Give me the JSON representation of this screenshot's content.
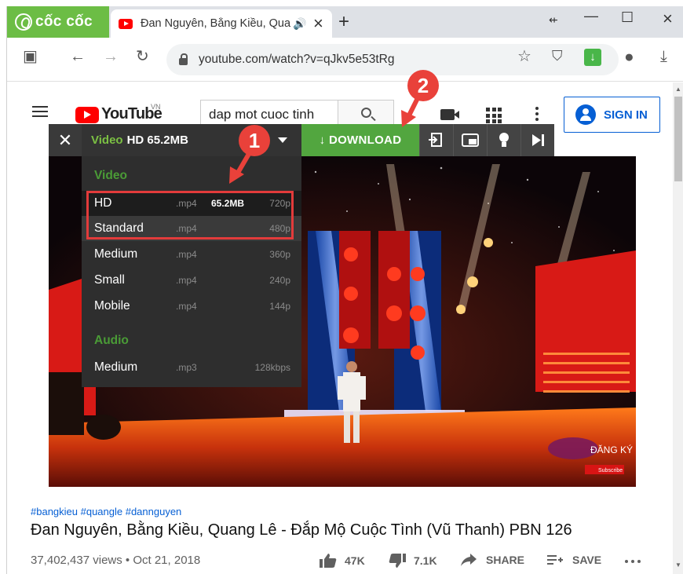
{
  "browser": {
    "brand_name": "cốc cốc",
    "tab_title": "Đan Nguyên, Bằng Kiều, Quang Lê - Đắp Mộ Cuộc Tình",
    "new_tab_label": "+",
    "url": "youtube.com/watch?v=qJkv5e53tRg",
    "icons": [
      "back-arrow-icon",
      "forward-arrow-icon",
      "reload-icon",
      "star-icon",
      "shield-icon",
      "download-extension-icon",
      "profile-icon",
      "download-icon",
      "sidebar-icon",
      "minimize-icon",
      "maximize-icon",
      "close-icon"
    ]
  },
  "youtube": {
    "logo_word": "YouTube",
    "region": "VN",
    "search_value": "dap mot cuoc tinh",
    "sign_in": "SIGN IN"
  },
  "downloader": {
    "selected_label": "Video",
    "selected_quality": "HD 65.2MB",
    "download_label": "↓ DOWNLOAD",
    "groups": [
      {
        "title": "Video",
        "items": [
          {
            "quality": "HD",
            "ext": ".mp4",
            "size": "65.2MB",
            "res": "720p"
          },
          {
            "quality": "Standard",
            "ext": ".mp4",
            "size": "",
            "res": "480p"
          },
          {
            "quality": "Medium",
            "ext": ".mp4",
            "size": "",
            "res": "360p"
          },
          {
            "quality": "Small",
            "ext": ".mp4",
            "size": "",
            "res": "240p"
          },
          {
            "quality": "Mobile",
            "ext": ".mp4",
            "size": "",
            "res": "144p"
          }
        ]
      },
      {
        "title": "Audio",
        "items": [
          {
            "quality": "Medium",
            "ext": ".mp3",
            "size": "",
            "res": "128kbps"
          }
        ]
      }
    ]
  },
  "annotations": {
    "badge1": "1",
    "badge2": "2",
    "accent": "#e9413a"
  },
  "video_info": {
    "hashtags": "#bangkieu #quangle #dannguyen",
    "title": "Đan Nguyên, Bằng Kiều, Quang Lê - Đắp Mộ Cuộc Tình (Vũ Thanh) PBN 126",
    "meta": "37,402,437 views • Oct 21, 2018",
    "likes": "47K",
    "dislikes": "7.1K",
    "share": "SHARE",
    "save": "SAVE"
  },
  "watermark": {
    "text": "ĐĂNG KÝ",
    "subscribe": "Subscribe"
  },
  "colors": {
    "coccoc_green": "#6cbd45",
    "download_green": "#52a63f",
    "menu_green": "#4a9b36",
    "yt_red": "#ff0000",
    "yt_blue": "#065fd4"
  }
}
